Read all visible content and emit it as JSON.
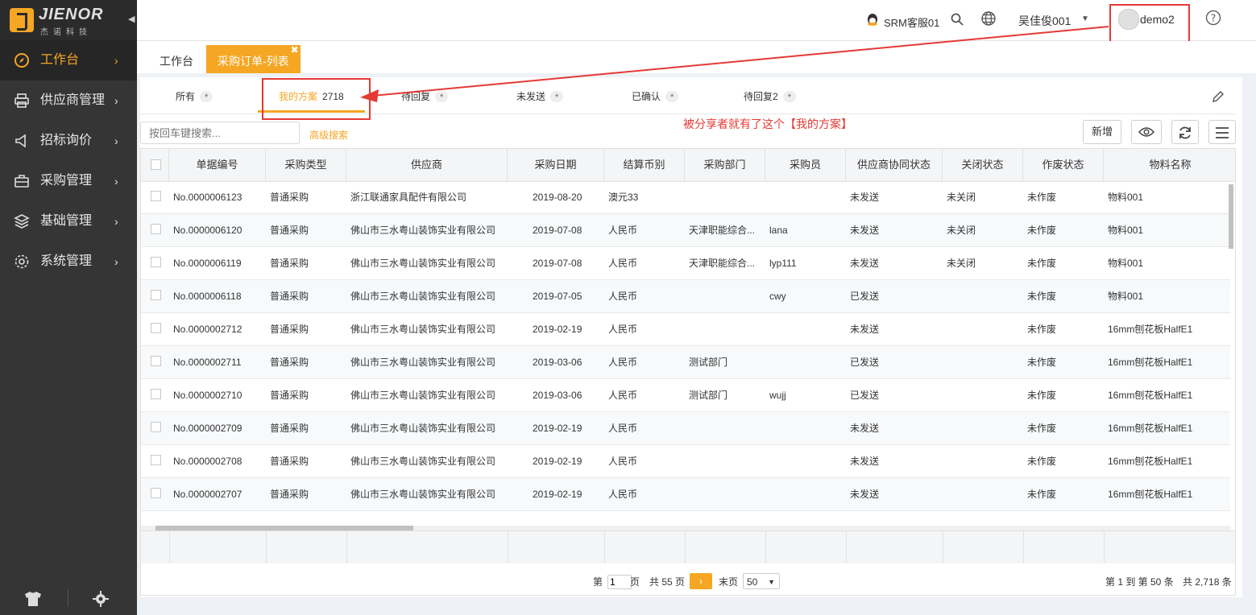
{
  "brand": {
    "name": "JIENOR",
    "sub": "杰诺科技"
  },
  "nav": [
    {
      "label": "工作台",
      "icon": "compass-icon",
      "active": true
    },
    {
      "label": "供应商管理",
      "icon": "printer-icon"
    },
    {
      "label": "招标询价",
      "icon": "megaphone-icon"
    },
    {
      "label": "采购管理",
      "icon": "briefcase-icon"
    },
    {
      "label": "基础管理",
      "icon": "layers-icon"
    },
    {
      "label": "系统管理",
      "icon": "gear-icon"
    }
  ],
  "topbar": {
    "service": "SRM客服01",
    "user_dropdown": "吴佳俊001",
    "account": "demo2"
  },
  "page_tabs": [
    {
      "label": "工作台"
    },
    {
      "label": "采购订单-列表"
    }
  ],
  "schemes": [
    {
      "label": "所有",
      "badge": "*"
    },
    {
      "label": "我的方案",
      "badge": "2718"
    },
    {
      "label": "待回复",
      "badge": "*"
    },
    {
      "label": "未发送",
      "badge": "*"
    },
    {
      "label": "已确认",
      "badge": "*"
    },
    {
      "label": "待回复2",
      "badge": "*"
    }
  ],
  "annotation": "被分享者就有了这个【我的方案】",
  "search": {
    "placeholder": "按回车键搜索...",
    "advanced": "高级搜索"
  },
  "toolbar": {
    "new_label": "新增"
  },
  "columns": [
    "单据编号",
    "采购类型",
    "供应商",
    "采购日期",
    "结算币别",
    "采购部门",
    "采购员",
    "供应商协同状态",
    "关闭状态",
    "作废状态",
    "物料名称"
  ],
  "rows": [
    [
      "No.0000006123",
      "普通采购",
      "浙江联通家具配件有限公司",
      "2019-08-20",
      "澳元33",
      "",
      "",
      "未发送",
      "未关闭",
      "未作废",
      "物料001"
    ],
    [
      "No.0000006120",
      "普通采购",
      "佛山市三水粤山装饰实业有限公司",
      "2019-07-08",
      "人民币",
      "天津职能综合...",
      "lana",
      "未发送",
      "未关闭",
      "未作废",
      "物料001"
    ],
    [
      "No.0000006119",
      "普通采购",
      "佛山市三水粤山装饰实业有限公司",
      "2019-07-08",
      "人民币",
      "天津职能综合...",
      "lyp111",
      "未发送",
      "未关闭",
      "未作废",
      "物料001"
    ],
    [
      "No.0000006118",
      "普通采购",
      "佛山市三水粤山装饰实业有限公司",
      "2019-07-05",
      "人民币",
      "",
      "cwy",
      "已发送",
      "",
      "未作废",
      "物料001"
    ],
    [
      "No.0000002712",
      "普通采购",
      "佛山市三水粤山装饰实业有限公司",
      "2019-02-19",
      "人民币",
      "",
      "",
      "未发送",
      "",
      "未作废",
      "16mm刨花板HalfE1"
    ],
    [
      "No.0000002711",
      "普通采购",
      "佛山市三水粤山装饰实业有限公司",
      "2019-03-06",
      "人民币",
      "测试部门",
      "",
      "已发送",
      "",
      "未作废",
      "16mm刨花板HalfE1"
    ],
    [
      "No.0000002710",
      "普通采购",
      "佛山市三水粤山装饰实业有限公司",
      "2019-03-06",
      "人民币",
      "测试部门",
      "wujj",
      "已发送",
      "",
      "未作废",
      "16mm刨花板HalfE1"
    ],
    [
      "No.0000002709",
      "普通采购",
      "佛山市三水粤山装饰实业有限公司",
      "2019-02-19",
      "人民币",
      "",
      "",
      "未发送",
      "",
      "未作废",
      "16mm刨花板HalfE1"
    ],
    [
      "No.0000002708",
      "普通采购",
      "佛山市三水粤山装饰实业有限公司",
      "2019-02-19",
      "人民币",
      "",
      "",
      "未发送",
      "",
      "未作废",
      "16mm刨花板HalfE1"
    ],
    [
      "No.0000002707",
      "普通采购",
      "佛山市三水粤山装饰实业有限公司",
      "2019-02-19",
      "人民币",
      "",
      "",
      "未发送",
      "",
      "未作废",
      "16mm刨花板HalfE1"
    ]
  ],
  "pager": {
    "page_prefix": "第",
    "page_value": "1",
    "page_suffix": "页",
    "total_pages": "共 55 页",
    "last": "末页",
    "page_size": "50",
    "range": "第 1 到 第 50 条",
    "total": "共 2,718 条"
  },
  "colors": {
    "accent": "#f5a623",
    "sidebar": "#353535",
    "annotation": "#e53935"
  }
}
